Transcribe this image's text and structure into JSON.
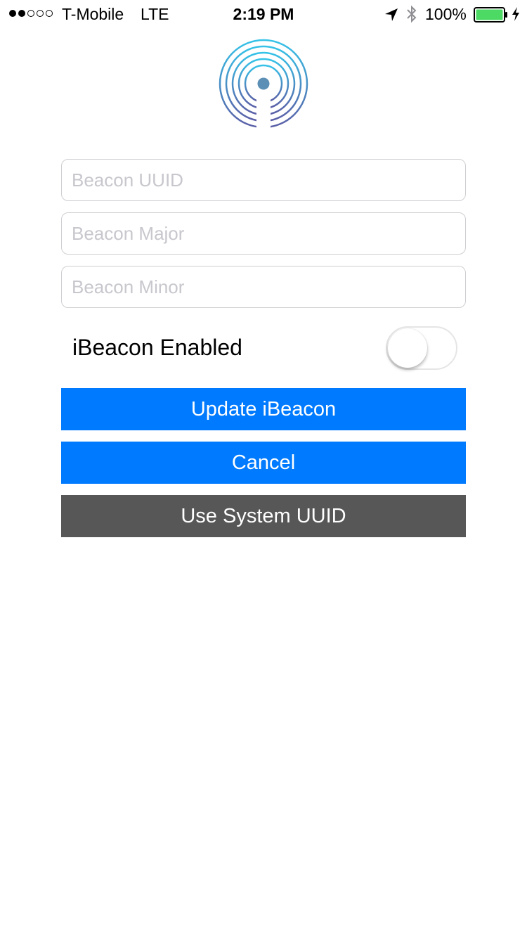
{
  "status_bar": {
    "signal_bars": [
      true,
      true,
      false,
      false,
      false
    ],
    "carrier": "T-Mobile",
    "network": "LTE",
    "time": "2:19 PM",
    "location_icon": "location-arrow-icon",
    "bluetooth_icon": "bluetooth-icon",
    "battery_percent": "100%",
    "battery_level": 1.0,
    "charging_icon": "charging-bolt-icon",
    "battery_color": "#4cd964"
  },
  "logo": {
    "icon": "beacon-signal-icon",
    "colors": [
      "#36c3e8",
      "#5b5ea6"
    ]
  },
  "form": {
    "uuid": {
      "value": "",
      "placeholder": "Beacon UUID"
    },
    "major": {
      "value": "",
      "placeholder": "Beacon Major"
    },
    "minor": {
      "value": "",
      "placeholder": "Beacon Minor"
    },
    "ibeacon_toggle": {
      "label": "iBeacon Enabled",
      "enabled": false
    }
  },
  "buttons": {
    "update_label": "Update iBeacon",
    "cancel_label": "Cancel",
    "system_uuid_label": "Use System UUID",
    "primary_color": "#007aff",
    "secondary_color": "#575757"
  }
}
